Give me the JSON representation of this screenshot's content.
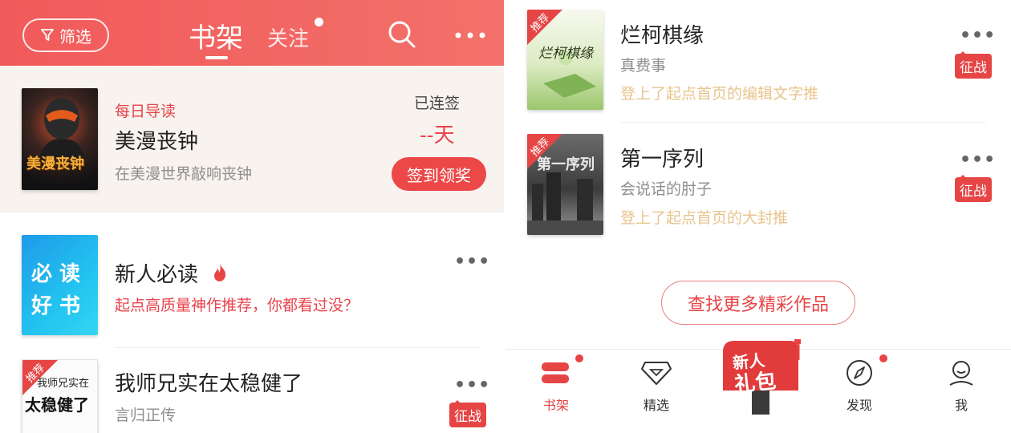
{
  "header": {
    "filter_label": "筛选",
    "tab_bookshelf": "书架",
    "tab_follow": "关注"
  },
  "checkin": {
    "tag": "每日导读",
    "title": "美漫丧钟",
    "desc": "在美漫世界敲响丧钟",
    "cover_text": "美漫丧钟",
    "streak_label": "已连签",
    "streak_value": "--天",
    "button": "签到领奖"
  },
  "left_list": [
    {
      "title": "新人必读",
      "subtitle": "起点高质量神作推荐，你都看过没？",
      "cover_lines": [
        "必 读",
        "好 书"
      ]
    },
    {
      "title": "我师兄实在太稳健了",
      "author": "言归正传",
      "badge": "征战",
      "ribbon": "推荐",
      "cover_top": "我师兄实在",
      "cover_main": "太稳健了"
    }
  ],
  "right_list": [
    {
      "title": "烂柯棋缘",
      "author": "真费事",
      "note": "登上了起点首页的编辑文字推",
      "badge": "征战",
      "ribbon": "推荐",
      "cover_text": "烂柯棋缘"
    },
    {
      "title": "第一序列",
      "author": "会说话的肘子",
      "note": "登上了起点首页的大封推",
      "badge": "征战",
      "ribbon": "推荐",
      "cover_text": "第一序列"
    }
  ],
  "find_more": "查找更多精彩作品",
  "nav": {
    "bookshelf": "书架",
    "featured": "精选",
    "gift_line1": "新人",
    "gift_line2": "礼包",
    "discover": "发现",
    "me": "我"
  },
  "colors": {
    "accent": "#e64545",
    "header": "#f15a5a",
    "gold_note": "#e8c48d"
  }
}
